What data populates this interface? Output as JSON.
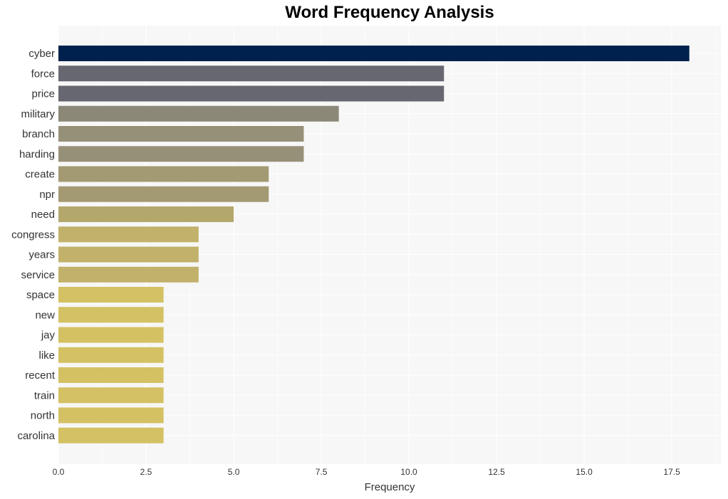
{
  "chart_data": {
    "type": "bar",
    "orientation": "horizontal",
    "title": "Word Frequency Analysis",
    "xlabel": "Frequency",
    "ylabel": "",
    "xlim": [
      0,
      18.9
    ],
    "xticks": [
      "0.0",
      "2.5",
      "5.0",
      "7.5",
      "10.0",
      "12.5",
      "15.0",
      "17.5"
    ],
    "xtick_values": [
      0,
      2.5,
      5,
      7.5,
      10,
      12.5,
      15,
      17.5
    ],
    "grid": true,
    "categories": [
      "cyber",
      "force",
      "price",
      "military",
      "branch",
      "harding",
      "create",
      "npr",
      "need",
      "congress",
      "years",
      "service",
      "space",
      "new",
      "jay",
      "like",
      "recent",
      "train",
      "north",
      "carolina"
    ],
    "values": [
      18,
      11,
      11,
      8,
      7,
      7,
      6,
      6,
      5,
      4,
      4,
      4,
      3,
      3,
      3,
      3,
      3,
      3,
      3,
      3
    ],
    "colors": [
      "#00214d",
      "#666770",
      "#666770",
      "#8b8877",
      "#979078",
      "#979078",
      "#a39a73",
      "#a39a73",
      "#b3a76c",
      "#c2b16b",
      "#c2b16b",
      "#c2b16b",
      "#d3c163",
      "#d3c163",
      "#d3c163",
      "#d3c163",
      "#d3c163",
      "#d3c163",
      "#d3c163",
      "#d3c163"
    ],
    "background": "#f7f7f7"
  }
}
